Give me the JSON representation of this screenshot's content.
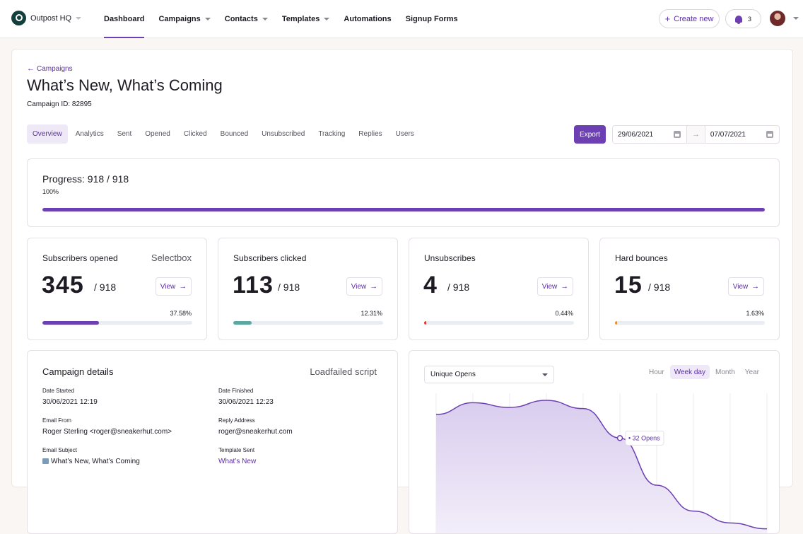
{
  "nav": {
    "brand": "Outpost HQ",
    "links": [
      {
        "label": "Dashboard",
        "active": true,
        "dropdown": false
      },
      {
        "label": "Campaigns",
        "active": false,
        "dropdown": true
      },
      {
        "label": "Contacts",
        "active": false,
        "dropdown": true
      },
      {
        "label": "Templates",
        "active": false,
        "dropdown": true
      },
      {
        "label": "Automations",
        "active": false,
        "dropdown": false
      },
      {
        "label": "Signup Forms",
        "active": false,
        "dropdown": false
      }
    ],
    "create_label": "Create new",
    "notification_count": "3"
  },
  "header": {
    "back_label": "Campaigns",
    "title": "What’s New, What’s Coming",
    "campaign_id": "Campaign ID: 82895"
  },
  "tabs": [
    "Overview",
    "Analytics",
    "Sent",
    "Opened",
    "Clicked",
    "Bounced",
    "Unsubscribed",
    "Tracking",
    "Replies",
    "Users"
  ],
  "active_tab": "Overview",
  "toolbar": {
    "export_label": "Export",
    "date_from": "29/06/2021",
    "date_to": "07/07/2021"
  },
  "progress": {
    "title": "Progress: 918 / 918",
    "percent_label": "100%",
    "fraction": 1.0,
    "color": "#6c3fb3"
  },
  "stats": [
    {
      "title": "Subscribers opened",
      "extra": "Selectbox",
      "value": "345",
      "total": "/ 918",
      "view": "View",
      "percent": "37.58%",
      "fraction": 0.3758,
      "color": "#6c3fb3"
    },
    {
      "title": "Subscribers clicked",
      "extra": "",
      "value": "113",
      "total": "/ 918",
      "view": "View",
      "percent": "12.31%",
      "fraction": 0.1231,
      "color": "#5aa8a0"
    },
    {
      "title": "Unsubscribes",
      "extra": "",
      "value": "4",
      "total": "/ 918",
      "view": "View",
      "percent": "0.44%",
      "fraction": 0.0044,
      "color": "#e0392b"
    },
    {
      "title": "Hard bounces",
      "extra": "",
      "value": "15",
      "total": "/ 918",
      "view": "View",
      "percent": "1.63%",
      "fraction": 0.0163,
      "color": "#f08a24"
    }
  ],
  "details": {
    "title": "Campaign details",
    "extra": "Loadfailed script",
    "fields": [
      {
        "label": "Date Started",
        "value": "30/06/2021 12:19"
      },
      {
        "label": "Date Finished",
        "value": "30/06/2021 12:23"
      },
      {
        "label": "Email From",
        "value": "Roger Sterling <roger@sneakerhut.com>"
      },
      {
        "label": "Reply Address",
        "value": "roger@sneakerhut.com"
      },
      {
        "label": "Email Subject",
        "value": "What’s New, What’s Coming"
      },
      {
        "label": "Template Sent",
        "value": "What’s New"
      }
    ]
  },
  "chart_panel": {
    "metric_selected": "Unique Opens",
    "granularity": [
      "Hour",
      "Week day",
      "Month",
      "Year"
    ],
    "granularity_active": "Week day",
    "tooltip": "• 32 Opens",
    "fill_color": "#d9cdee",
    "line_color": "#6c3fb3"
  },
  "chart_data": {
    "type": "area",
    "x_points": 10,
    "series": [
      {
        "values": [
          52,
          62,
          58,
          64,
          57,
          32,
          -8,
          -30,
          -40,
          -45
        ]
      }
    ],
    "highlight_index": 5,
    "ylim": [
      -50,
      70
    ],
    "grid": true
  }
}
